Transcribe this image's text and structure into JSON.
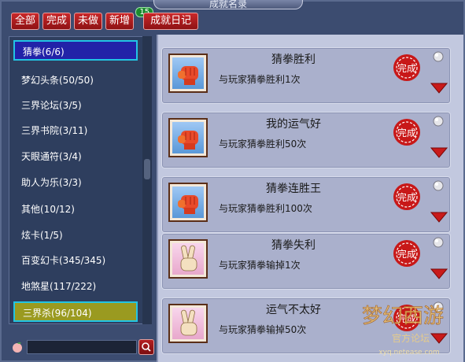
{
  "window": {
    "title": "成就名录"
  },
  "topbar": {
    "all": "全部",
    "done": "完成",
    "undone": "未做",
    "new_label": "新增",
    "new_count": "15",
    "diary": "成就日记"
  },
  "sidebar": {
    "items": [
      {
        "label": "猜拳(6/6)"
      },
      {
        "label": "梦幻头条(50/50)"
      },
      {
        "label": "三界论坛(3/5)"
      },
      {
        "label": "三界书院(3/11)"
      },
      {
        "label": "天眼通符(3/4)"
      },
      {
        "label": "助人为乐(3/3)"
      },
      {
        "label": "其他(10/12)"
      },
      {
        "label": "炫卡(1/5)"
      },
      {
        "label": "百变幻卡(345/345)"
      },
      {
        "label": "地煞星(117/222)"
      },
      {
        "label": "三界杀(96/104)"
      }
    ]
  },
  "search": {
    "value": "",
    "placeholder": ""
  },
  "cards": [
    {
      "title": "猜拳胜利",
      "desc": "与玩家猜拳胜利1次",
      "icon": "fist-icon",
      "seal": "完成"
    },
    {
      "title": "我的运气好",
      "desc": "与玩家猜拳胜利50次",
      "icon": "fist-icon",
      "seal": "完成"
    },
    {
      "title": "猜拳连胜王",
      "desc": "与玩家猜拳胜利100次",
      "icon": "fist-icon",
      "seal": "完成"
    },
    {
      "title": "猜拳失利",
      "desc": "与玩家猜拳输掉1次",
      "icon": "victory-hand-icon",
      "seal": "完成"
    },
    {
      "title": "运气不太好",
      "desc": "与玩家猜拳输掉50次",
      "icon": "victory-hand-icon",
      "seal": "完成"
    }
  ],
  "watermark": {
    "line1": "梦幻西游",
    "line2": "官方论坛",
    "url": "xyq.netease.com"
  },
  "colors": {
    "accent_red": "#b81c1e",
    "selection_cyan": "#22c4e4",
    "seal_red": "#c81818"
  }
}
